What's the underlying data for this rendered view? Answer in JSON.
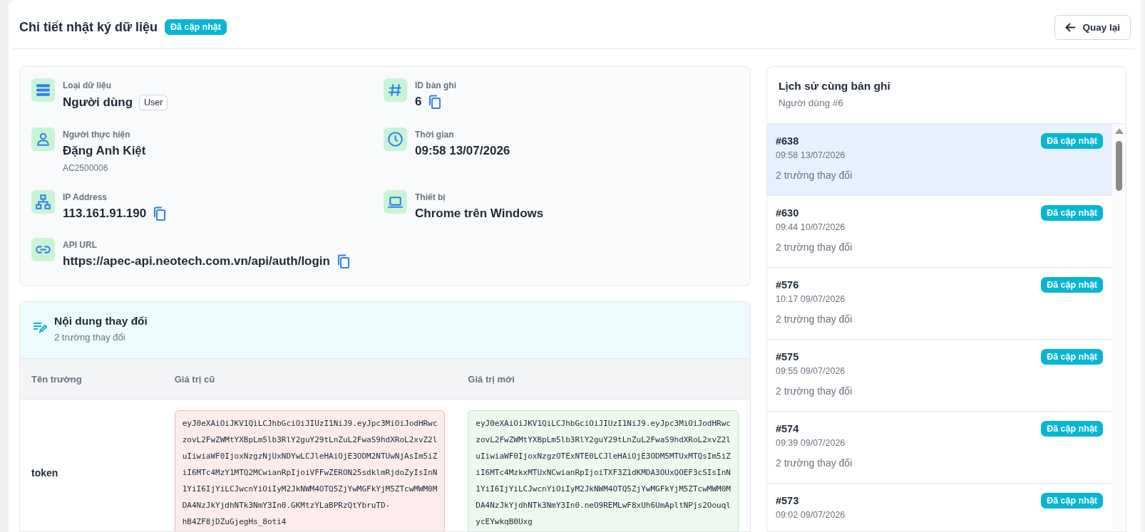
{
  "header": {
    "title": "Chi tiết nhật ký dữ liệu",
    "status": "Đã cập nhật",
    "back_button": "Quay lại"
  },
  "info": [
    {
      "kind": "data-type",
      "label": "Loại dữ liệu",
      "value": "Người dùng",
      "tag": "User",
      "copyable": false
    },
    {
      "kind": "record-id",
      "label": "ID bản ghi",
      "value": "6",
      "copyable": true
    },
    {
      "kind": "user",
      "label": "Người thực hiện",
      "value": "Đặng Anh Kiệt",
      "sub": "AC2500006",
      "copyable": false
    },
    {
      "kind": "time",
      "label": "Thời gian",
      "value": "09:58 13/07/2026",
      "copyable": false
    },
    {
      "kind": "ip",
      "label": "IP Address",
      "value": "113.161.91.190",
      "copyable": true
    },
    {
      "kind": "device",
      "label": "Thiết bị",
      "value": "Chrome trên Windows",
      "copyable": false
    },
    {
      "kind": "url",
      "label": "API URL",
      "value": "https://apec-api.neotech.com.vn/api/auth/login",
      "copyable": true
    }
  ],
  "changes": {
    "title": "Nội dung thay đổi",
    "subtitle": "2 trường thay đổi",
    "columns": [
      "Tên trường",
      "Giá trị cũ",
      "Giá trị mới"
    ],
    "rows": [
      {
        "field": "token",
        "old": "eyJ0eXAiOiJKV1QiLCJhbGciOiJIUzI1NiJ9.eyJpc3MiOiJodHRwczovL2FwZWMtYXBpLm5lb3RlY2guY29tLnZuL2FwaS9hdXRoL2xvZ2luIiwiaWF0IjoxNzgzNjUxNDYwLCJleHAiOjE3ODM2NTUwNjAsIm5iZiI6MTc4MzY1MTQ2MCwianRpIjoiVFFwZERON25sdklmRjdoZyIsInN1YiI6IjYiLCJwcnYiOiIyM2JkNWM4OTQ5ZjYwMGFkYjM5ZTcwMWM0MDA4NzJkYjdhNTk3NmY3In0.GKMtzYLaBPRzQtYbruTD-hB4ZF8jDZuGjegHs_8oti4",
        "new": "eyJ0eXAiOiJKV1QiLCJhbGciOiJIUzI1NiJ9.eyJpc3MiOiJodHRwczovL2FwZWMtYXBpLm5lb3RlY2guY29tLnZuL2FwaS9hdXRoL2xvZ2luIiwiaWF0IjoxNzgzOTExNTE0LCJleHAiOjE3ODM5MTUxMTQsIm5iZiI6MTc4MzkxMTUxNCwianRpIjoiTXF3Z1dKMDA3OUxQOEF3cSIsInN1YiI6IjYiLCJwcnYiOiIyM2JkNWM4OTQ5ZjYwMGFkYjM5ZTcwMWM0MDA4NzJkYjdhNTk3NmY3In0.neO9REMLwF8xUh6UmApltNPjs2OouqlycEYwkqB0Uxg"
      }
    ]
  },
  "history": {
    "title": "Lịch sử cùng bản ghi",
    "subtitle": "Người dùng #6",
    "items": [
      {
        "id": "#638",
        "time": "09:58 13/07/2026",
        "status": "Đã cập nhật",
        "changes": "2 trường thay đổi",
        "selected": true
      },
      {
        "id": "#630",
        "time": "09:44 10/07/2026",
        "status": "Đã cập nhật",
        "changes": "2 trường thay đổi",
        "selected": false
      },
      {
        "id": "#576",
        "time": "10:17 09/07/2026",
        "status": "Đã cập nhật",
        "changes": "2 trường thay đổi",
        "selected": false
      },
      {
        "id": "#575",
        "time": "09:55 09/07/2026",
        "status": "Đã cập nhật",
        "changes": "2 trường thay đổi",
        "selected": false
      },
      {
        "id": "#574",
        "time": "09:39 09/07/2026",
        "status": "Đã cập nhật",
        "changes": "2 trường thay đổi",
        "selected": false
      },
      {
        "id": "#573",
        "time": "09:02 09/07/2026",
        "status": "Đã cập nhật",
        "selected": false
      }
    ]
  }
}
